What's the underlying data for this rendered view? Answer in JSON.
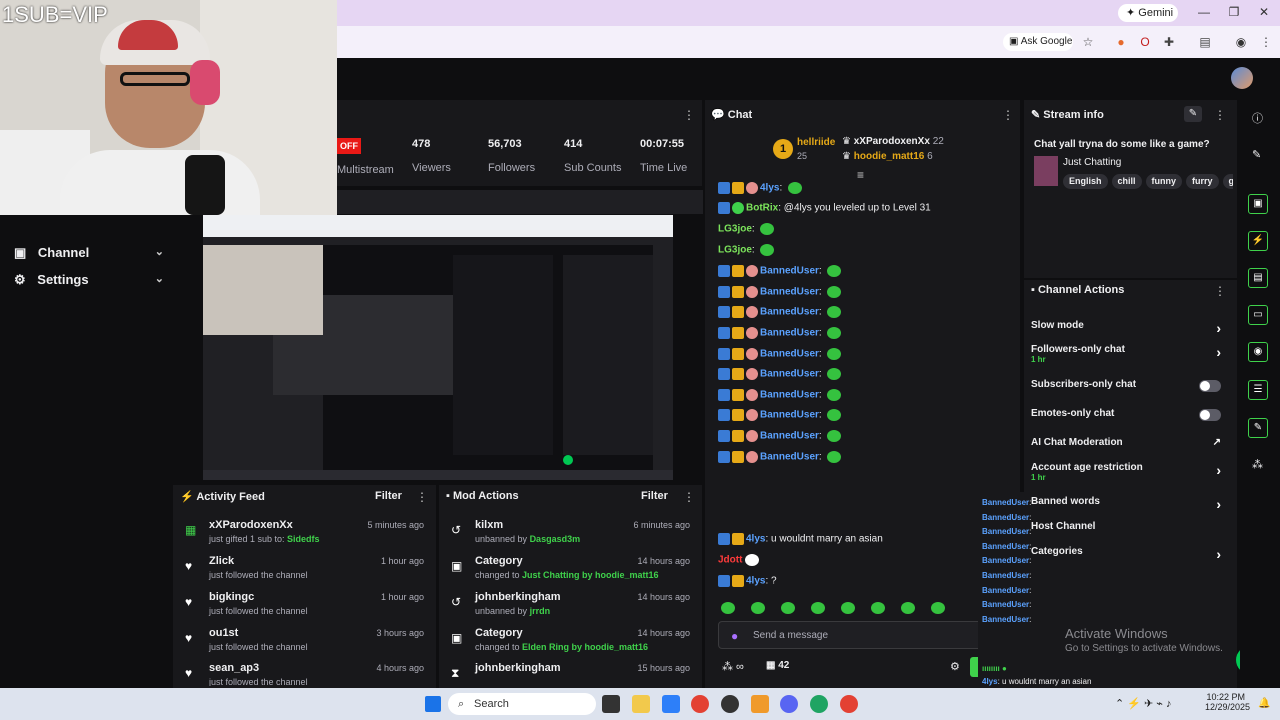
{
  "overlay": {
    "text": "1SUB=VIP"
  },
  "browser": {
    "gemini_label": "Gemini",
    "ask_google": "Ask Google"
  },
  "nav": {
    "items": [
      {
        "label": "Channel",
        "icon": "tv-icon"
      },
      {
        "label": "Settings",
        "icon": "gear-icon"
      }
    ]
  },
  "stats": {
    "status": "OFF",
    "status_label": "Multistream",
    "items": [
      {
        "value": "478",
        "label": "Viewers"
      },
      {
        "value": "56,703",
        "label": "Followers"
      },
      {
        "value": "414",
        "label": "Sub Counts"
      },
      {
        "value": "00:07:55",
        "label": "Time Live"
      }
    ]
  },
  "activity_feed": {
    "title": "Activity Feed",
    "filter": "Filter",
    "items": [
      {
        "name": "xXParodoxenXx",
        "sub_prefix": "just gifted 1 sub to: ",
        "sub_highlight": "Sidedfs",
        "time": "5 minutes ago",
        "icon": "gift-icon"
      },
      {
        "name": "Zlick",
        "sub": "just followed the channel",
        "time": "1 hour ago",
        "icon": "heart-icon"
      },
      {
        "name": "bigkingc",
        "sub": "just followed the channel",
        "time": "1 hour ago",
        "icon": "heart-icon"
      },
      {
        "name": "ou1st",
        "sub": "just followed the channel",
        "time": "3 hours ago",
        "icon": "heart-icon"
      },
      {
        "name": "sean_ap3",
        "sub": "just followed the channel",
        "time": "4 hours ago",
        "icon": "heart-icon"
      }
    ]
  },
  "mod_actions": {
    "title": "Mod Actions",
    "filter": "Filter",
    "items": [
      {
        "name": "kilxm",
        "sub_prefix": "unbanned by ",
        "sub_highlight": "Dasgasd3m",
        "sub_suffix": "",
        "time": "6 minutes ago"
      },
      {
        "name": "Category",
        "sub_prefix": "changed to ",
        "sub_highlight": "Just Chatting",
        "sub_suffix": " by hoodie_matt16",
        "time": "14 hours ago"
      },
      {
        "name": "johnberkingham",
        "sub_prefix": "unbanned by ",
        "sub_highlight": "jrrdn",
        "sub_suffix": "",
        "time": "14 hours ago"
      },
      {
        "name": "Category",
        "sub_prefix": "changed to ",
        "sub_highlight": "Elden Ring",
        "sub_suffix": " by hoodie_matt16",
        "time": "14 hours ago"
      },
      {
        "name": "johnberkingham",
        "sub_prefix": "",
        "sub_highlight": "",
        "sub_suffix": "",
        "time": "15 hours ago"
      }
    ]
  },
  "chat": {
    "title": "Chat",
    "leader_rank": "1",
    "leader_name": "hellriide",
    "leader_count": "25",
    "top_users": [
      {
        "name": "xXParodoxenXx",
        "count": "22"
      },
      {
        "name": "hoodie_matt16",
        "count": "6"
      }
    ],
    "messages": [
      {
        "user": "4lys",
        "text": "",
        "color": "blue"
      },
      {
        "user": "BotRix",
        "text": "@4lys you leveled up to Level 31",
        "color": "green"
      },
      {
        "user": "LG3joe",
        "text": "",
        "color": "green"
      },
      {
        "user": "LG3joe",
        "text": "",
        "color": "green"
      },
      {
        "user": "BannedUser",
        "text": "",
        "color": "blue"
      },
      {
        "user": "BannedUser",
        "text": "",
        "color": "blue"
      },
      {
        "user": "BannedUser",
        "text": "",
        "color": "blue"
      },
      {
        "user": "BannedUser",
        "text": "",
        "color": "blue"
      },
      {
        "user": "BannedUser",
        "text": "",
        "color": "blue"
      },
      {
        "user": "BannedUser",
        "text": "",
        "color": "blue"
      },
      {
        "user": "BannedUser",
        "text": "",
        "color": "blue"
      },
      {
        "user": "BannedUser",
        "text": "",
        "color": "blue"
      },
      {
        "user": "BannedUser",
        "text": "",
        "color": "blue"
      },
      {
        "user": "BannedUser",
        "text": "",
        "color": "blue"
      }
    ],
    "msg_marry": {
      "user": "4lys",
      "text": ": u wouldnt marry an asian"
    },
    "msg_jdott": {
      "user": "Jdott"
    },
    "msg_q": {
      "user": "4lys",
      "text": ": ?"
    },
    "input_placeholder": "Send a message",
    "viewer_count": "42",
    "send_label": "Chat"
  },
  "stream_info": {
    "title": "Stream info",
    "stream_title": "Chat yall tryna do some like a game?",
    "category": "Just Chatting",
    "tags": [
      "English",
      "chill",
      "funny",
      "furry",
      "ga"
    ]
  },
  "channel_actions": {
    "title": "Channel Actions",
    "items": [
      {
        "label": "Slow mode",
        "sub": "",
        "control": "arrow"
      },
      {
        "label": "Followers-only chat",
        "sub": "1 hr",
        "control": "arrow"
      },
      {
        "label": "Subscribers-only chat",
        "sub": "",
        "control": "toggle"
      },
      {
        "label": "Emotes-only chat",
        "sub": "",
        "control": "toggle"
      },
      {
        "label": "AI Chat Moderation",
        "sub": "",
        "control": "external"
      },
      {
        "label": "Account age restriction",
        "sub": "1 hr",
        "control": "arrow"
      },
      {
        "label": "Banned words",
        "sub": "",
        "control": "arrow"
      },
      {
        "label": "Host Channel",
        "sub": "",
        "control": "none"
      },
      {
        "label": "Categories",
        "sub": "",
        "control": "arrow"
      }
    ]
  },
  "overlay_chat": {
    "line1": "Jdott",
    "line2_user": "4lys",
    "line2_text": ": u wouldnt marry an asian",
    "line3_user": "4lys"
  },
  "watermark": {
    "title": "Activate Windows",
    "sub": "Go to Settings to activate Windows."
  },
  "taskbar": {
    "search": "Search",
    "time": "10:22 PM",
    "date": "12/29/2025"
  },
  "colors": {
    "accent": "#3fd14b",
    "bg": "#0e0e10",
    "panel": "#18181b",
    "off": "#e91916"
  }
}
